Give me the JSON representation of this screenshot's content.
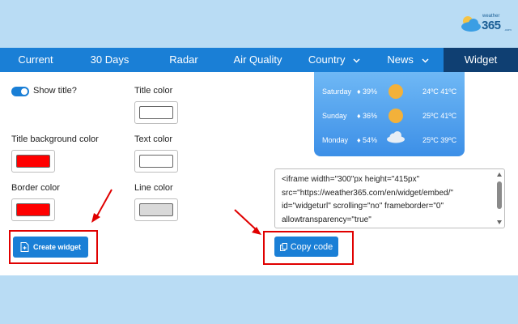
{
  "logo": {
    "small": "weather",
    "big": "365",
    "suffix": ".com"
  },
  "nav": {
    "items": [
      {
        "label": "Current"
      },
      {
        "label": "30 Days"
      },
      {
        "label": "Radar"
      },
      {
        "label": "Air Quality"
      },
      {
        "label": "Country"
      },
      {
        "label": "News"
      },
      {
        "label": "Widget"
      }
    ]
  },
  "form": {
    "show_title_label": "Show title?",
    "title_color_label": "Title color",
    "title_bg_label": "Title background color",
    "text_color_label": "Text color",
    "border_color_label": "Border color",
    "line_color_label": "Line color",
    "colors": {
      "title": "#ffffff",
      "title_bg": "#ff0000",
      "text": "#ffffff",
      "border": "#ff0000",
      "line": "#d9d9d9"
    },
    "create_button": "Create widget",
    "copy_button": "Copy code"
  },
  "widget_preview": {
    "rows": [
      {
        "day": "Saturday",
        "humidity": "39%",
        "temp": "24ºC 41ºC",
        "icon": "sun-icon"
      },
      {
        "day": "Sunday",
        "humidity": "36%",
        "temp": "25ºC 41ºC",
        "icon": "sun-icon"
      },
      {
        "day": "Monday",
        "humidity": "54%",
        "temp": "25ºC 39ºC",
        "icon": "cloud-icon"
      }
    ]
  },
  "embed_code": "<iframe width=\"300\"px height=\"415px\" src=\"https://weather365.com/en/widget/embed/\" id=\"widgeturl\" scrolling=\"no\" frameborder=\"0\" allowtransparency=\"true\"",
  "accent": "#1a7fd6",
  "highlight": "#e00000"
}
